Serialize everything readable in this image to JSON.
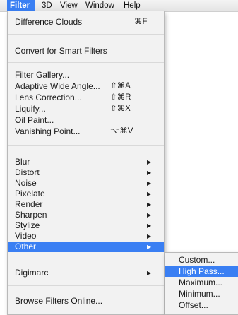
{
  "menubar": {
    "items": [
      "Filter",
      "3D",
      "View",
      "Window",
      "Help"
    ]
  },
  "filter_menu": {
    "difference_clouds": "Difference Clouds",
    "difference_clouds_shortcut": "⌘F",
    "convert_smart": "Convert for Smart Filters",
    "filter_gallery": "Filter Gallery...",
    "adaptive_wide_angle": "Adaptive Wide Angle...",
    "adaptive_wide_angle_shortcut": "⇧⌘A",
    "lens_correction": "Lens Correction...",
    "lens_correction_shortcut": "⇧⌘R",
    "liquify": "Liquify...",
    "liquify_shortcut": "⇧⌘X",
    "oil_paint": "Oil Paint...",
    "vanishing_point": "Vanishing Point...",
    "vanishing_point_shortcut": "⌥⌘V",
    "blur": "Blur",
    "distort": "Distort",
    "noise": "Noise",
    "pixelate": "Pixelate",
    "render": "Render",
    "sharpen": "Sharpen",
    "stylize": "Stylize",
    "video": "Video",
    "other": "Other",
    "digimarc": "Digimarc",
    "browse_online": "Browse Filters Online...",
    "arrow": "▶"
  },
  "other_submenu": {
    "custom": "Custom...",
    "high_pass": "High Pass...",
    "maximum": "Maximum...",
    "minimum": "Minimum...",
    "offset": "Offset..."
  },
  "colors": {
    "highlight": "#3a7ff3",
    "menu_bg": "#f2f2f2"
  }
}
